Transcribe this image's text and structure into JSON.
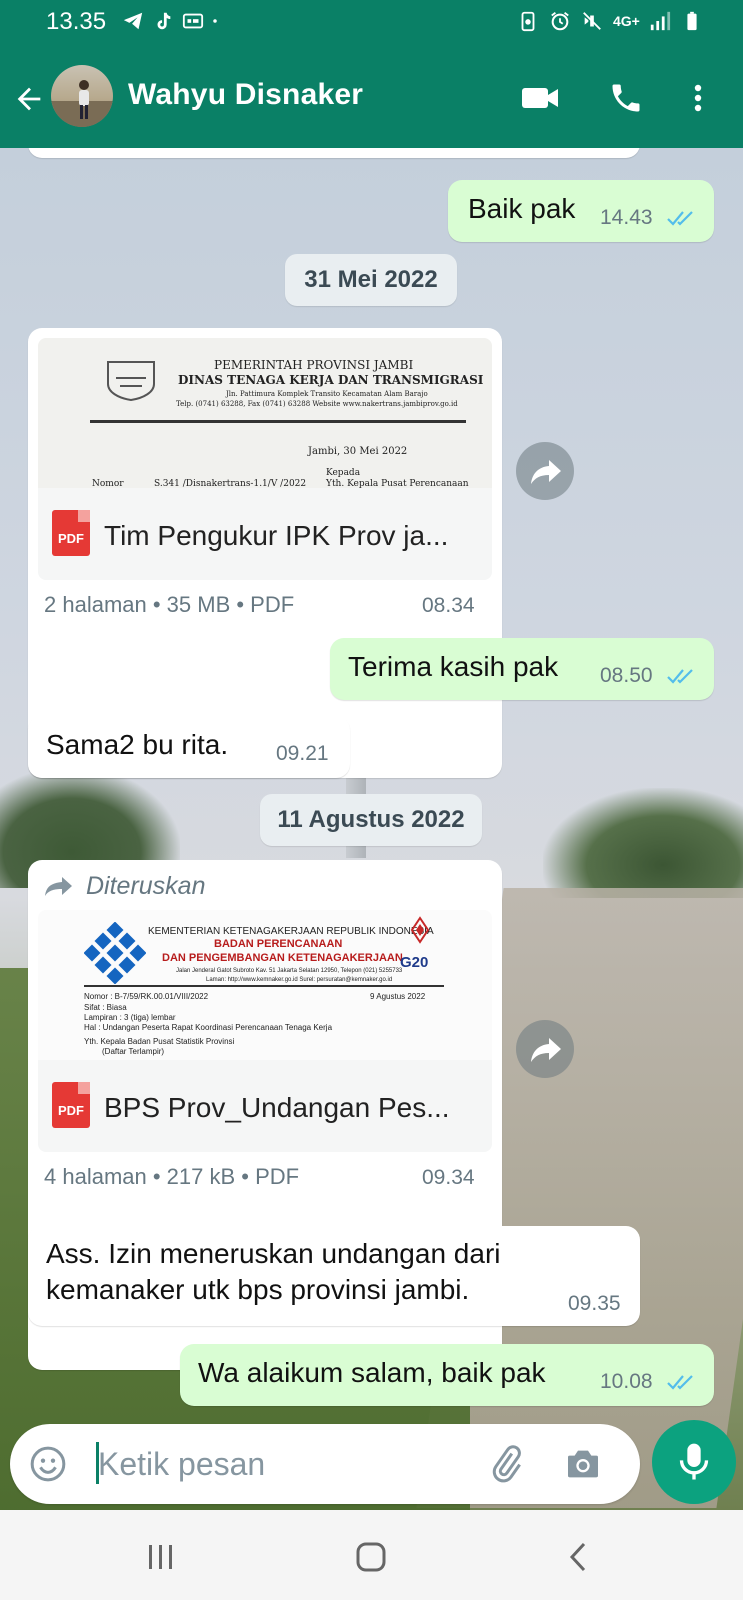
{
  "status_bar": {
    "time": "13.35",
    "left_icons": [
      "telegram-icon",
      "tiktok-icon",
      "cast-icon",
      "dot-icon"
    ],
    "network": "4G+",
    "right_icons": [
      "alarm-icon",
      "vibrate-off-icon",
      "signal-icon",
      "battery-icon"
    ]
  },
  "header": {
    "contact_name": "Wahyu Disnaker",
    "icons": [
      "back-arrow-icon",
      "video-call-icon",
      "voice-call-icon",
      "more-vert-icon"
    ],
    "accent": "#0a8066"
  },
  "messages": [
    {
      "type": "text",
      "dir": "out",
      "text": "Baik pak",
      "time": "14.43",
      "read": true
    },
    {
      "type": "date",
      "text": "31 Mei 2022"
    },
    {
      "type": "document",
      "dir": "in",
      "preview": {
        "l1": "PEMERINTAH PROVINSI JAMBI",
        "l2": "DINAS TENAGA KERJA DAN TRANSMIGRASI",
        "l3": "Jln. Pattimura Komplek Transito Kecamatan Alam Barajo",
        "l4": "Telp. (0741) 63288, Fax (0741) 63288 Website www.nakertrans.jambiprov.go.id",
        "place_date": "Jambi, 30 Mei 2022",
        "kepada": "Kepada",
        "nomor_label": "Nomor",
        "nomor_value": "S.341 /Disnakertrans-1.1/V /2022",
        "yth": "Yth. Kepala Pusat Perencanaan"
      },
      "file_name": "Tim Pengukur IPK Prov ja...",
      "meta": "2 halaman • 35 MB • PDF",
      "time": "08.34"
    },
    {
      "type": "text",
      "dir": "out",
      "text": "Terima kasih pak",
      "time": "08.50",
      "read": true
    },
    {
      "type": "text",
      "dir": "in",
      "text": "Sama2 bu rita.",
      "time": "09.21"
    },
    {
      "type": "date",
      "text": "11 Agustus 2022"
    },
    {
      "type": "document",
      "dir": "in",
      "forwarded": "Diteruskan",
      "preview": {
        "l1": "KEMENTERIAN KETENAGAKERJAAN REPUBLIK INDONESIA",
        "l2": "BADAN PERENCANAAN",
        "l3": "DAN PENGEMBANGAN KETENAGAKERJAAN",
        "l4": "Jalan Jenderal Gatot Subroto Kav. 51 Jakarta Selatan 12950, Telepon (021) 5255733",
        "l5": "Laman: http://www.kemnaker.go.id Surel: persuratan@kemnaker.go.id",
        "g20": "G20",
        "nomor": "Nomor    :  B-7/59/RK.00.01/VIII/2022",
        "date": "9 Agustus 2022",
        "sifat": "Sifat      :  Biasa",
        "lampiran": "Lampiran  :  3 (tiga) lembar",
        "hal": "Hal        :  Undangan Peserta Rapat Koordinasi Perencanaan Tenaga Kerja",
        "yth": "Yth. Kepala Badan Pusat Statistik Provinsi",
        "daftar": "(Daftar Terlampir)"
      },
      "file_name": "BPS Prov_Undangan Pes...",
      "meta": "4 halaman • 217 kB • PDF",
      "time": "09.34"
    },
    {
      "type": "text",
      "dir": "in",
      "text_line1": "Ass. Izin meneruskan undangan dari",
      "text_line2": "kemanaker utk bps provinsi jambi.",
      "time": "09.35"
    },
    {
      "type": "text",
      "dir": "out",
      "text": "Wa alaikum salam, baik pak",
      "time": "10.08",
      "read": true
    }
  ],
  "composer": {
    "placeholder": "Ketik pesan",
    "icons": [
      "emoji-icon",
      "attach-icon",
      "camera-icon",
      "mic-icon"
    ]
  },
  "nav_bar": {
    "icons": [
      "recent-apps-icon",
      "home-icon",
      "back-nav-icon"
    ]
  },
  "colors": {
    "outgoing_bubble": "#d9fdd3",
    "incoming_bubble": "#ffffff",
    "read_ticks": "#53bdeb",
    "pdf_red": "#e53935",
    "mic_button": "#0ca27f"
  }
}
